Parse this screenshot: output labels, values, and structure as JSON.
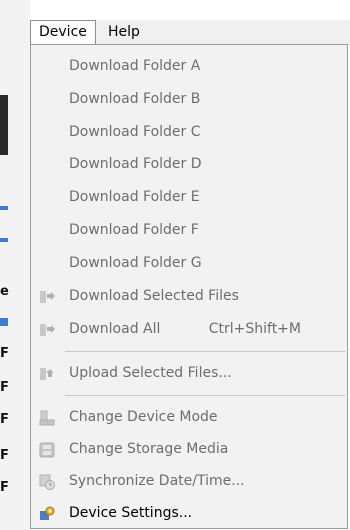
{
  "menubar": {
    "items": [
      {
        "label": "Device",
        "active": true
      },
      {
        "label": "Help",
        "active": false
      }
    ]
  },
  "menu": {
    "items": [
      {
        "label": "Download Folder A",
        "enabled": false,
        "icon": "none"
      },
      {
        "label": "Download Folder B",
        "enabled": false,
        "icon": "none"
      },
      {
        "label": "Download Folder C",
        "enabled": false,
        "icon": "none"
      },
      {
        "label": "Download Folder D",
        "enabled": false,
        "icon": "none"
      },
      {
        "label": "Download Folder E",
        "enabled": false,
        "icon": "none"
      },
      {
        "label": "Download Folder F",
        "enabled": false,
        "icon": "none"
      },
      {
        "label": "Download Folder G",
        "enabled": false,
        "icon": "none"
      },
      {
        "label": "Download Selected Files",
        "enabled": false,
        "icon": "download-arrow-icon"
      },
      {
        "label": "Download All",
        "shortcut": "Ctrl+Shift+M",
        "enabled": false,
        "icon": "download-arrow-icon"
      },
      {
        "label": "Upload Selected Files...",
        "enabled": false,
        "icon": "upload-arrow-icon"
      },
      {
        "label": "Change Device Mode",
        "enabled": false,
        "icon": "device-mode-icon"
      },
      {
        "label": "Change Storage Media",
        "enabled": false,
        "icon": "storage-media-icon"
      },
      {
        "label": "Synchronize Date/Time...",
        "enabled": false,
        "icon": "sync-clock-icon"
      },
      {
        "label": "Device Settings...",
        "enabled": true,
        "icon": "device-settings-icon"
      }
    ]
  },
  "background": {
    "letters": [
      "e",
      "F",
      "F",
      "F",
      "F",
      "F"
    ]
  },
  "colors": {
    "disabled_text": "#6d6d6d",
    "enabled_text": "#000000",
    "menu_background": "#f2f2f2",
    "menu_border": "#9a9a9a"
  }
}
